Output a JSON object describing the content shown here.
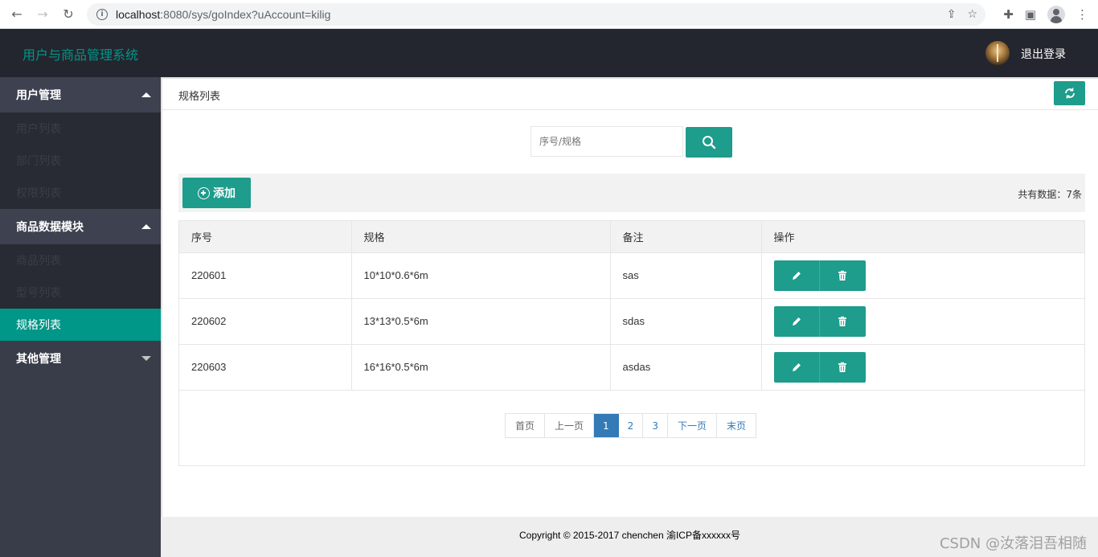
{
  "browser": {
    "url_host": "localhost",
    "url_path": ":8080/sys/goIndex?uAccount=kilig"
  },
  "header": {
    "logo": "用户与商品管理系统",
    "logout": "退出登录"
  },
  "sidebar": {
    "groups": [
      {
        "title": "用户管理",
        "items": [
          "用户列表",
          "部门列表",
          "权限列表"
        ]
      },
      {
        "title": "商品数据模块",
        "items": [
          "商品列表",
          "型号列表",
          "规格列表"
        ]
      },
      {
        "title": "其他管理",
        "items": []
      }
    ],
    "active_item": "规格列表"
  },
  "page": {
    "title": "规格列表",
    "search_placeholder": "序号/规格",
    "add_label": "添加",
    "total": "共有数据：7条"
  },
  "table": {
    "headers": [
      "序号",
      "规格",
      "备注",
      "操作"
    ],
    "rows": [
      {
        "id": "220601",
        "spec": "10*10*0.6*6m",
        "note": "sas"
      },
      {
        "id": "220602",
        "spec": "13*13*0.5*6m",
        "note": "sdas"
      },
      {
        "id": "220603",
        "spec": "16*16*0.5*6m",
        "note": "asdas"
      }
    ]
  },
  "pager": {
    "first": "首页",
    "prev": "上一页",
    "pages": [
      "1",
      "2",
      "3"
    ],
    "current": "1",
    "next": "下一页",
    "last": "末页"
  },
  "footer": {
    "text": "Copyright © 2015-2017 chenchen 渝ICP备xxxxxx号",
    "watermark": "CSDN @汝落泪吾相随"
  },
  "colors": {
    "accent": "#009688",
    "button": "#1e9c8c",
    "header_bg": "#23262e",
    "sidebar_bg": "#393d49",
    "pager_active": "#337ab7"
  },
  "icons": {
    "search": "search-icon",
    "refresh": "refresh-icon",
    "edit": "pencil-icon",
    "delete": "trash-icon",
    "add": "plus-circle-icon"
  }
}
